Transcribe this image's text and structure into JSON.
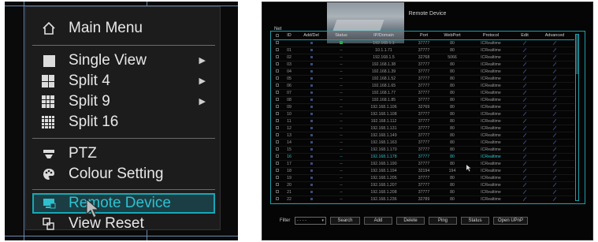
{
  "menu": {
    "items": [
      {
        "label": "Main Menu",
        "icon": "home-icon"
      },
      {
        "label": "Single View",
        "icon": "square-icon",
        "submenu": true
      },
      {
        "label": "Split 4",
        "icon": "grid-4-icon",
        "submenu": true
      },
      {
        "label": "Split 9",
        "icon": "grid-9-icon",
        "submenu": true
      },
      {
        "label": "Split 16",
        "icon": "grid-16-icon"
      },
      {
        "label": "PTZ",
        "icon": "ptz-icon"
      },
      {
        "label": "Colour Setting",
        "icon": "palette-icon"
      },
      {
        "label": "Remote Device",
        "icon": "remote-device-icon",
        "highlighted": true
      },
      {
        "label": "View Reset",
        "icon": "view-reset-icon"
      }
    ],
    "highlight_color": "#18a7b5"
  },
  "remote_device": {
    "title": "Remote Device",
    "net_label": "Net",
    "columns": [
      "ID",
      "Add/Del",
      "Status",
      "IP/Domain",
      "Port",
      "WebPort",
      "Protocol",
      "Edit",
      "Advanced"
    ],
    "rows": [
      {
        "id": "",
        "status": "ok",
        "ip": "192.168.1.1",
        "port": "37777",
        "webport": "80",
        "protocol": "ICRealtime"
      },
      {
        "id": "01",
        "status": "--",
        "ip": "10.1.1.71",
        "port": "37777",
        "webport": "80",
        "protocol": "ICRealtime"
      },
      {
        "id": "02",
        "status": "--",
        "ip": "192.168.1.5",
        "port": "32768",
        "webport": "5066",
        "protocol": "ICRealtime"
      },
      {
        "id": "03",
        "status": "--",
        "ip": "192.168.1.38",
        "port": "37777",
        "webport": "80",
        "protocol": "ICRealtime"
      },
      {
        "id": "04",
        "status": "--",
        "ip": "192.168.1.39",
        "port": "37777",
        "webport": "80",
        "protocol": "ICRealtime"
      },
      {
        "id": "05",
        "status": "--",
        "ip": "192.168.1.52",
        "port": "37777",
        "webport": "80",
        "protocol": "ICRealtime"
      },
      {
        "id": "06",
        "status": "--",
        "ip": "192.168.1.65",
        "port": "37777",
        "webport": "80",
        "protocol": "ICRealtime"
      },
      {
        "id": "07",
        "status": "--",
        "ip": "192.168.1.77",
        "port": "37777",
        "webport": "80",
        "protocol": "ICRealtime"
      },
      {
        "id": "08",
        "status": "--",
        "ip": "192.168.1.85",
        "port": "37777",
        "webport": "80",
        "protocol": "ICRealtime"
      },
      {
        "id": "09",
        "status": "--",
        "ip": "192.168.1.106",
        "port": "32769",
        "webport": "80",
        "protocol": "ICRealtime"
      },
      {
        "id": "10",
        "status": "--",
        "ip": "192.168.1.108",
        "port": "37777",
        "webport": "80",
        "protocol": "ICRealtime"
      },
      {
        "id": "11",
        "status": "--",
        "ip": "192.168.1.112",
        "port": "37777",
        "webport": "80",
        "protocol": "ICRealtime"
      },
      {
        "id": "12",
        "status": "--",
        "ip": "192.168.1.131",
        "port": "37777",
        "webport": "80",
        "protocol": "ICRealtime"
      },
      {
        "id": "13",
        "status": "--",
        "ip": "192.168.1.149",
        "port": "37777",
        "webport": "80",
        "protocol": "ICRealtime"
      },
      {
        "id": "14",
        "status": "--",
        "ip": "192.168.1.163",
        "port": "37777",
        "webport": "80",
        "protocol": "ICRealtime"
      },
      {
        "id": "15",
        "status": "--",
        "ip": "192.168.1.170",
        "port": "37777",
        "webport": "80",
        "protocol": "ICRealtime"
      },
      {
        "id": "16",
        "status": "--",
        "ip": "192.168.1.178",
        "port": "37777",
        "webport": "80",
        "protocol": "ICRealtime",
        "selected": true
      },
      {
        "id": "17",
        "status": "--",
        "ip": "192.168.1.190",
        "port": "37777",
        "webport": "80",
        "protocol": "ICRealtime"
      },
      {
        "id": "18",
        "status": "--",
        "ip": "192.168.1.194",
        "port": "32194",
        "webport": "194",
        "protocol": "ICRealtime"
      },
      {
        "id": "19",
        "status": "--",
        "ip": "192.168.1.205",
        "port": "37777",
        "webport": "80",
        "protocol": "ICRealtime"
      },
      {
        "id": "20",
        "status": "--",
        "ip": "192.168.1.207",
        "port": "37777",
        "webport": "80",
        "protocol": "ICRealtime"
      },
      {
        "id": "21",
        "status": "--",
        "ip": "192.168.1.208",
        "port": "37777",
        "webport": "80",
        "protocol": "ICRealtime"
      },
      {
        "id": "22",
        "status": "--",
        "ip": "192.168.1.236",
        "port": "32789",
        "webport": "80",
        "protocol": "ICRealtime"
      }
    ],
    "filter_label": "Filter",
    "filter_value": "- - - -",
    "buttons": [
      "Search",
      "Add",
      "Delete",
      "Ping",
      "Status",
      "Open UPnP"
    ],
    "accent_color": "#1aa0ac"
  }
}
